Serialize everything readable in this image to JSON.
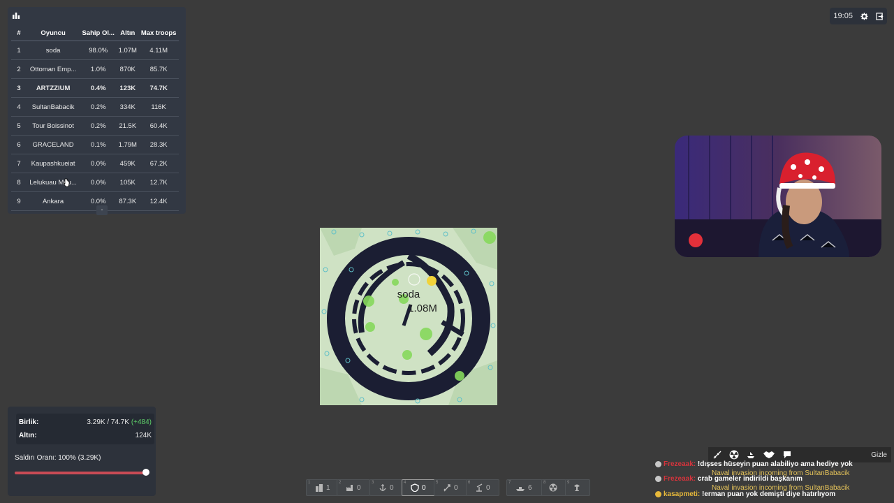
{
  "leaderboard": {
    "columns": [
      "#",
      "Oyuncu",
      "Sahip Ol...",
      "Altın",
      "Max troops"
    ],
    "rows": [
      {
        "rank": "1",
        "name": "soda",
        "owned": "98.0%",
        "gold": "1.07M",
        "troops": "4.11M"
      },
      {
        "rank": "2",
        "name": "Ottoman Emp...",
        "owned": "1.0%",
        "gold": "870K",
        "troops": "85.7K"
      },
      {
        "rank": "3",
        "name": "ARTZZIUM",
        "owned": "0.4%",
        "gold": "123K",
        "troops": "74.7K"
      },
      {
        "rank": "4",
        "name": "SultanBabacik",
        "owned": "0.2%",
        "gold": "334K",
        "troops": "116K"
      },
      {
        "rank": "5",
        "name": "Tour Boissinot",
        "owned": "0.2%",
        "gold": "21.5K",
        "troops": "60.4K"
      },
      {
        "rank": "6",
        "name": "GRACELAND",
        "owned": "0.1%",
        "gold": "1.79M",
        "troops": "28.3K"
      },
      {
        "rank": "7",
        "name": "Kaupashkueiat",
        "owned": "0.0%",
        "gold": "459K",
        "troops": "67.2K"
      },
      {
        "rank": "8",
        "name": "Lelukuau Mou...",
        "owned": "0.0%",
        "gold": "105K",
        "troops": "12.7K"
      },
      {
        "rank": "9",
        "name": "Ankara",
        "owned": "0.0%",
        "gold": "87.3K",
        "troops": "12.4K"
      }
    ],
    "collapse_label": "-"
  },
  "topbar": {
    "time": "19:05"
  },
  "map": {
    "player_name": "soda",
    "player_troops": "1.08M"
  },
  "stats": {
    "troops_label": "Birlik:",
    "troops_value": "3.29K / 74.7K",
    "troops_delta": "(+484)",
    "gold_label": "Altın:",
    "gold_value": "124K",
    "attack_ratio": "Saldırı Oranı: 100% (3.29K)",
    "attack_ratio_fraction": 1.0
  },
  "toolbar": [
    {
      "key": "1",
      "icon": "city-icon",
      "count": "1"
    },
    {
      "key": "2",
      "icon": "factory-icon",
      "count": "0"
    },
    {
      "key": "3",
      "icon": "port-icon",
      "count": "0"
    },
    {
      "key": "4",
      "icon": "defense-icon",
      "count": "0"
    },
    {
      "key": "5",
      "icon": "missile-silo-icon",
      "count": "0"
    },
    {
      "key": "6",
      "icon": "sam-launcher-icon",
      "count": "0"
    },
    {
      "key": "7",
      "icon": "warship-icon",
      "count": "6"
    },
    {
      "key": "8",
      "icon": "nuke-icon",
      "count": ""
    },
    {
      "key": "9",
      "icon": "hydrogen-bomb-icon",
      "count": ""
    }
  ],
  "chat": {
    "hide_label": "Gizle",
    "messages": [
      {
        "user": "Frezeaak:",
        "text": "!dışses hüseyin puan alabiliyo ama hediye yok",
        "user_color": "#d6343c"
      },
      {
        "user": "Frezeaak:",
        "text": "crab gameler indirildi başkanım",
        "user_color": "#d6343c"
      },
      {
        "user": "kasapmeti:",
        "text": "!erman puan yok demişti diye hatırlıyom",
        "user_color": "#e8b93a"
      }
    ],
    "naval_alerts": [
      "Naval invasion incoming from SultanBabacik",
      "Naval invasion incoming from SultanBabacik"
    ]
  }
}
